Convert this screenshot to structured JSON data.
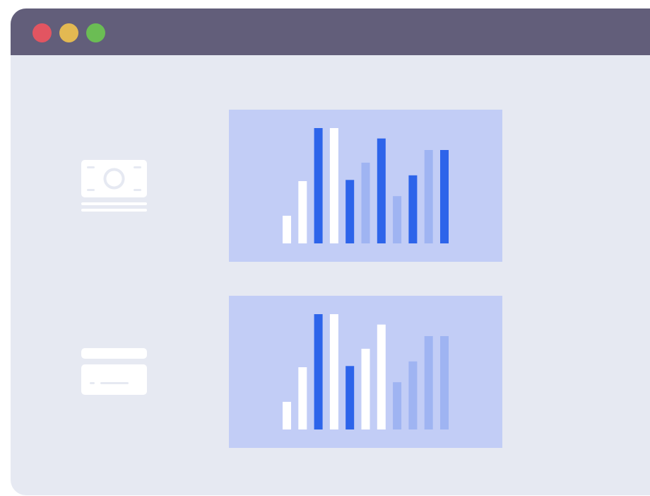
{
  "window": {
    "titlebar_color": "#625e7a",
    "body_color": "#e6e9f2",
    "controls": [
      {
        "name": "close",
        "color": "#e25561"
      },
      {
        "name": "minimize",
        "color": "#e3b952"
      },
      {
        "name": "maximize",
        "color": "#6bbd54"
      }
    ]
  },
  "sidebar": {
    "icons": [
      "banknote-icon",
      "credit-card-icon"
    ],
    "icon_color": "#ffffff"
  },
  "colors": {
    "panel": "#c2cdf6",
    "white": "#ffffff",
    "blue": "#2d64ea",
    "light": "#9fb4f2"
  },
  "chart_data": [
    {
      "type": "bar",
      "values": [
        24,
        54,
        100,
        100,
        55,
        70,
        91,
        41,
        59,
        81,
        81
      ],
      "bar_colors": [
        "white",
        "white",
        "blue",
        "white",
        "blue",
        "light",
        "blue",
        "light",
        "blue",
        "light",
        "blue"
      ],
      "ylim": [
        0,
        100
      ],
      "grid": false
    },
    {
      "type": "bar",
      "values": [
        24,
        54,
        100,
        100,
        55,
        70,
        91,
        41,
        59,
        81,
        81
      ],
      "bar_colors": [
        "white",
        "white",
        "blue",
        "white",
        "blue",
        "white",
        "white",
        "light",
        "light",
        "light",
        "light"
      ],
      "ylim": [
        0,
        100
      ],
      "grid": false
    }
  ]
}
